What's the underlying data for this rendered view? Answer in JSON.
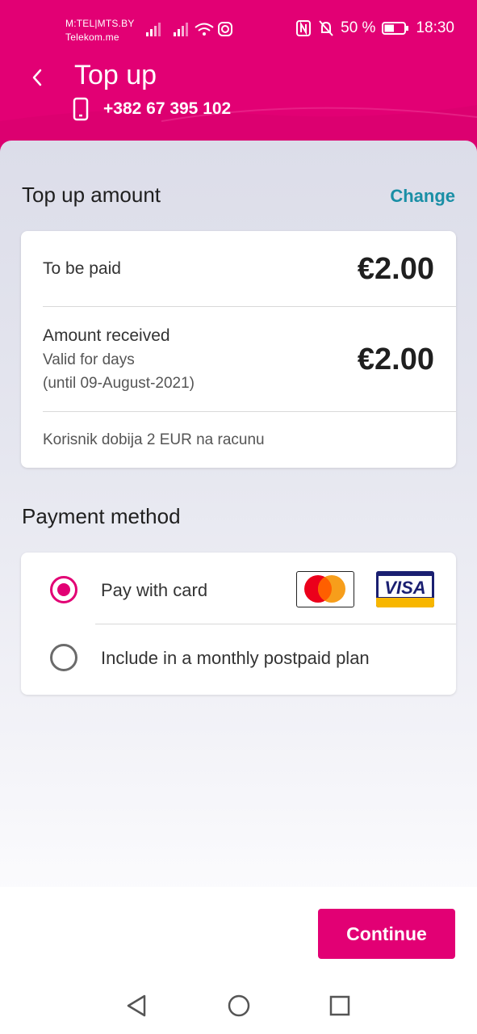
{
  "status_bar": {
    "carrier_line1": "M:TEL|MTS.BY",
    "carrier_line2": "Telekom.me",
    "battery_percent": "50 %",
    "time": "18:30",
    "battery_level": 0.5
  },
  "header": {
    "title": "Top up",
    "phone_number": "+382 67 395 102"
  },
  "amount_section": {
    "title": "Top up amount",
    "change_label": "Change",
    "to_be_paid_label": "To be paid",
    "to_be_paid_value": "€2.00",
    "amount_received_label": "Amount received",
    "valid_label": "Valid for days",
    "valid_until": "(until 09-August-2021)",
    "amount_received_value": "€2.00",
    "note": "Korisnik dobija 2 EUR na racunu"
  },
  "payment_section": {
    "title": "Payment method",
    "options": [
      {
        "label": "Pay with card",
        "selected": true
      },
      {
        "label": "Include in a monthly postpaid plan",
        "selected": false
      }
    ],
    "card_brands": {
      "visa": "VISA"
    }
  },
  "footer": {
    "continue_label": "Continue"
  },
  "colors": {
    "brand": "#e20074",
    "link": "#1a8fa6"
  },
  "icons": {
    "back": "chevron-left-icon",
    "phone": "phone-icon",
    "nfc": "nfc-icon",
    "mute": "bell-off-icon",
    "wifi": "wifi-icon",
    "instagram": "instagram-icon"
  }
}
